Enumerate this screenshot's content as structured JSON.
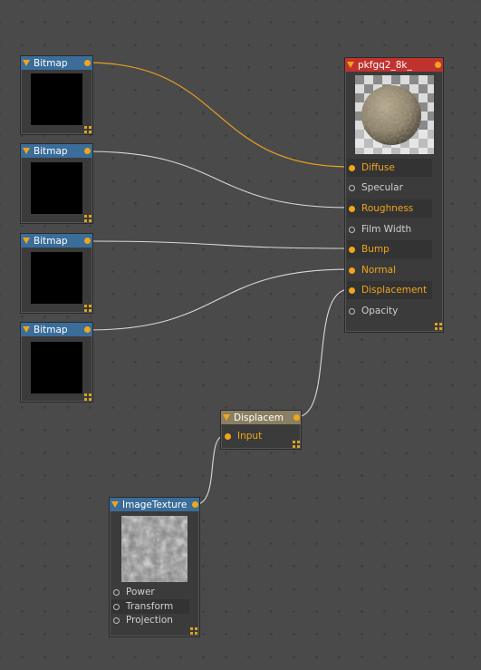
{
  "colors": {
    "wire_orange": "#e8a020",
    "wire_white": "#d8d8d8",
    "header_blue": "#3a6d9a",
    "header_red": "#c0322e",
    "header_tan": "#8a7f62",
    "accent": "#f0a51a"
  },
  "bitmap_nodes": [
    {
      "title": "Bitmap",
      "icon": "collapse-triangle-icon"
    },
    {
      "title": "Bitmap",
      "icon": "collapse-triangle-icon"
    },
    {
      "title": "Bitmap",
      "icon": "collapse-triangle-icon"
    },
    {
      "title": "Bitmap",
      "icon": "collapse-triangle-icon"
    }
  ],
  "material_node": {
    "title": "pkfgq2_8k_",
    "inputs": [
      {
        "label": "Diffuse",
        "connected": true
      },
      {
        "label": "Specular",
        "connected": false
      },
      {
        "label": "Roughness",
        "connected": true
      },
      {
        "label": "Film Width",
        "connected": false
      },
      {
        "label": "Bump",
        "connected": true
      },
      {
        "label": "Normal",
        "connected": true
      },
      {
        "label": "Displacement",
        "connected": true
      },
      {
        "label": "Opacity",
        "connected": false
      }
    ]
  },
  "displacement_node": {
    "title": "Displacem",
    "inputs": [
      {
        "label": "Input",
        "connected": true
      }
    ]
  },
  "image_texture_node": {
    "title": "ImageTexture",
    "inputs": [
      {
        "label": "Power",
        "connected": false
      },
      {
        "label": "Transform",
        "connected": false
      },
      {
        "label": "Projection",
        "connected": false
      }
    ]
  }
}
